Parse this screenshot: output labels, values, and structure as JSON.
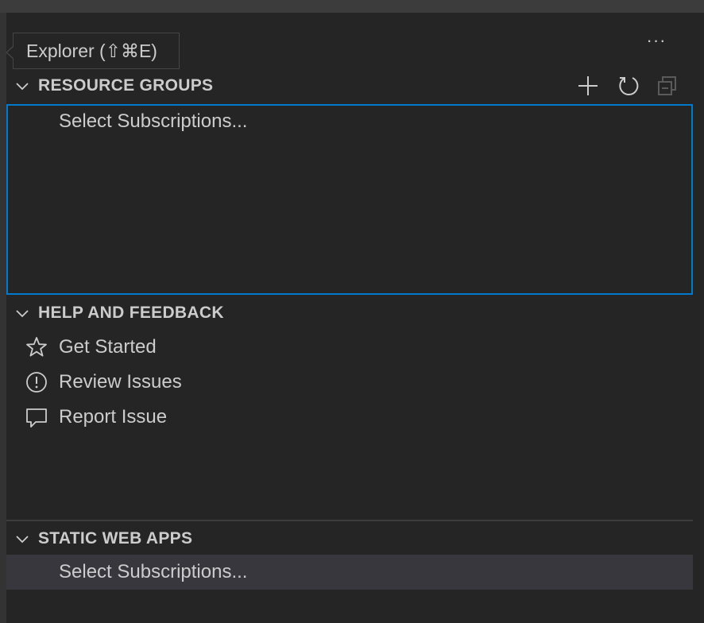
{
  "tooltip": {
    "text": "Explorer (⇧⌘E)"
  },
  "toolbar": {
    "more_label": "···"
  },
  "resource_groups": {
    "title": "RESOURCE GROUPS",
    "actions": [
      "plus-icon",
      "refresh-icon",
      "collapse-all-icon"
    ],
    "items": [
      {
        "label": "Select Subscriptions..."
      }
    ]
  },
  "help_feedback": {
    "title": "HELP AND FEEDBACK",
    "items": [
      {
        "label": "Get Started",
        "icon": "star-icon"
      },
      {
        "label": "Review Issues",
        "icon": "issues-icon"
      },
      {
        "label": "Report Issue",
        "icon": "comment-icon"
      }
    ]
  },
  "static_web_apps": {
    "title": "STATIC WEB APPS",
    "items": [
      {
        "label": "Select Subscriptions..."
      }
    ]
  },
  "colors": {
    "background": "#252526",
    "focus_border": "#007acc",
    "selection": "#37373d",
    "text": "#cccccc"
  }
}
